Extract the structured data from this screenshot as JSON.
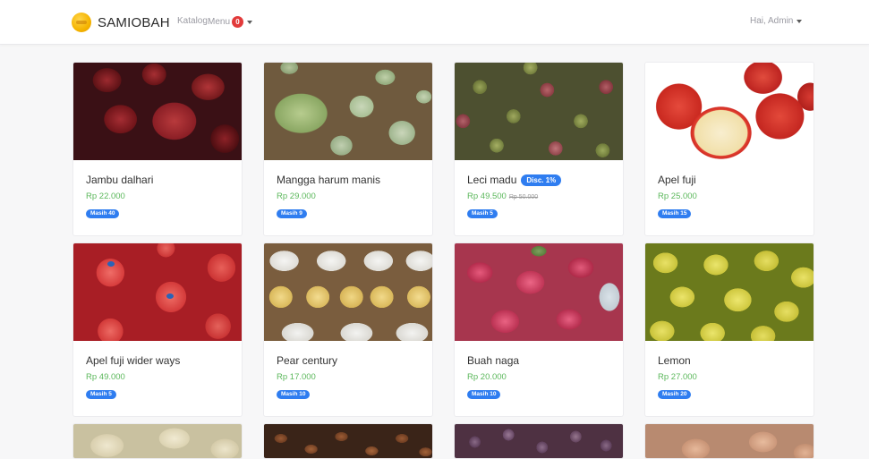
{
  "navbar": {
    "brand": "SAMIOBAH",
    "links": {
      "katalog": "Katalog",
      "menu": "Menu"
    },
    "menu_badge": "0",
    "user": "Hai, Admin"
  },
  "products": [
    {
      "name": "Jambu dalhari",
      "price": "Rp 22.000",
      "stock": "Masih 40",
      "discount": null,
      "old_price": null
    },
    {
      "name": "Mangga harum manis",
      "price": "Rp 29.000",
      "stock": "Masih 9",
      "discount": null,
      "old_price": null
    },
    {
      "name": "Leci madu",
      "price": "Rp 49.500",
      "stock": "Masih 5",
      "discount": "Disc. 1%",
      "old_price": "Rp 50.000"
    },
    {
      "name": "Apel fuji",
      "price": "Rp 25.000",
      "stock": "Masih 15",
      "discount": null,
      "old_price": null
    },
    {
      "name": "Apel fuji wider ways",
      "price": "Rp 49.000",
      "stock": "Masih 5",
      "discount": null,
      "old_price": null
    },
    {
      "name": "Pear century",
      "price": "Rp 17.000",
      "stock": "Masih 10",
      "discount": null,
      "old_price": null
    },
    {
      "name": "Buah naga",
      "price": "Rp 20.000",
      "stock": "Masih 10",
      "discount": null,
      "old_price": null
    },
    {
      "name": "Lemon",
      "price": "Rp 27.000",
      "stock": "Masih 20",
      "discount": null,
      "old_price": null
    }
  ],
  "colors": {
    "price": "#5cb85c",
    "badge": "#2f7df0",
    "menu_badge": "#e23a3a"
  }
}
